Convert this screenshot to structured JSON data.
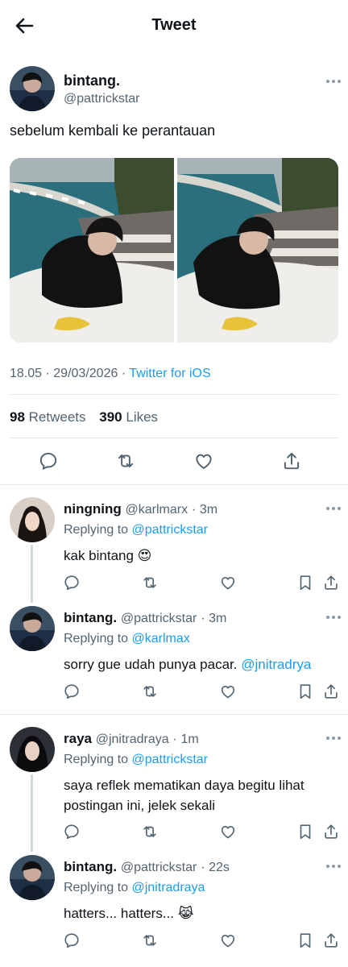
{
  "header": {
    "title": "Tweet",
    "back_icon": "arrow-left-icon"
  },
  "tweet": {
    "display_name": "bintang.",
    "handle": "@pattrickstar",
    "text": "sebelum kembali ke perantauan",
    "time": "18.05",
    "date": "29/03/2026",
    "separator": "·",
    "source": "Twitter for iOS",
    "retweets_count": "98",
    "retweets_label": "Retweets",
    "likes_count": "390",
    "likes_label": "Likes",
    "actions": [
      "reply-icon",
      "retweet-icon",
      "like-icon",
      "share-icon"
    ]
  },
  "replies": [
    {
      "display_name": "ningning",
      "handle": "@karlmarx",
      "dot": "·",
      "time": "3m",
      "replying_label": "Replying to",
      "replying_to": "@pattrickstar",
      "text": "kak bintang 😍",
      "mention": ""
    },
    {
      "display_name": "bintang.",
      "handle": "@pattrickstar",
      "dot": "·",
      "time": "3m",
      "replying_label": "Replying to",
      "replying_to": "@karlmax",
      "text": "sorry gue udah punya pacar. ",
      "mention": "@jnitradrya"
    },
    {
      "display_name": "raya",
      "handle": "@jnitradraya",
      "dot": "·",
      "time": "1m",
      "replying_label": "Replying to",
      "replying_to": "@pattrickstar",
      "text": "saya reflek mematikan daya begitu lihat postingan ini, jelek sekali",
      "mention": ""
    },
    {
      "display_name": "bintang.",
      "handle": "@pattrickstar",
      "dot": "·",
      "time": "22s",
      "replying_label": "Replying to",
      "replying_to": "@jnitradraya",
      "text": "hatters... hatters... 😹",
      "mention": ""
    }
  ],
  "colors": {
    "link": "#1d9bf0",
    "secondary_text": "#536471",
    "divider": "#e1e6ea"
  }
}
